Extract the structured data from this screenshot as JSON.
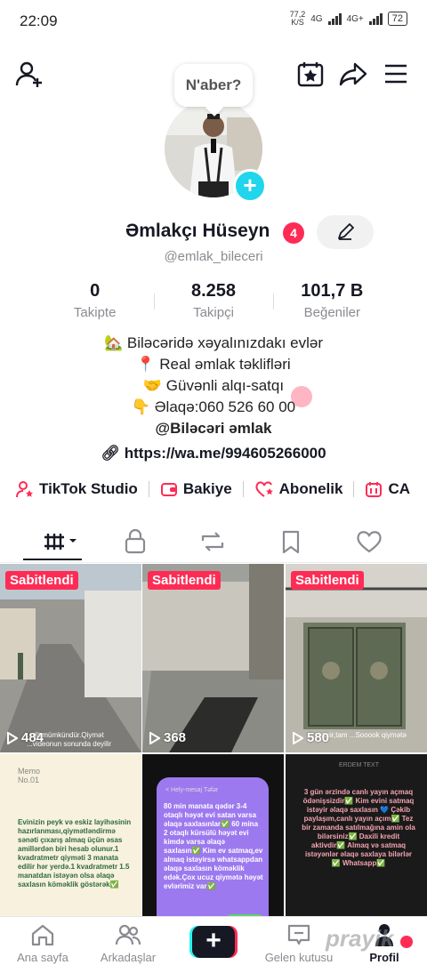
{
  "status_bar": {
    "time": "22:09",
    "speed_value": "77,2",
    "speed_unit": "K/S",
    "net1": "4G",
    "net2": "4G+",
    "battery": "72"
  },
  "header": {
    "bubble_text": "N'aber?"
  },
  "profile": {
    "name": "Əmlakçı Hüseyn",
    "badge_count": "4",
    "username": "@emlak_bileceri",
    "stats": [
      {
        "value": "0",
        "label": "Takipte"
      },
      {
        "value": "8.258",
        "label": "Takipçi"
      },
      {
        "value": "101,7 B",
        "label": "Beğeniler"
      }
    ],
    "bio": [
      "🏡 Biləcəridə xəyalınızdakı evlər",
      "📍 Real əmlak təklifləri",
      "🤝 Güvənli alqı-satqı",
      "👇 Əlaqə:060 526 60 00"
    ],
    "bio_bold": "@Biləcəri əmlak",
    "link": "https://wa.me/994605266000"
  },
  "tools": [
    {
      "label": "TikTok Studio",
      "icon": "person-star-icon"
    },
    {
      "label": "Bakiye",
      "icon": "wallet-icon"
    },
    {
      "label": "Abonelik",
      "icon": "heart-star-icon"
    },
    {
      "label": "CA",
      "icon": "calendar-icon"
    }
  ],
  "videos": [
    {
      "pinned": "Sabitlendi",
      "views": "484",
      "caption": "...dit mümkündür.Qiymət ...videonun sonunda deyilir"
    },
    {
      "pinned": "Sabitlendi",
      "views": "368"
    },
    {
      "pinned": "Sabitlendi",
      "views": "580",
      "caption": "...təmir,tam ...Sooook qiymətə"
    },
    {
      "header": "Memo\nNo.01",
      "text": "Evinizin peyk və eskiz layihəsinin hazırlanması,qiymətləndirmə sənəti çıxarış almaq üçün əsas amillərdən biri hesab olunur.1 kvadratmetr qiyməti 3 manata edilir hər yerdə.1 kvadratmetr 1.5 manatdan istəyən olsa əlaqə saxlasın köməklik göstərək✅"
    },
    {
      "header": "< Hely-mesaj Təfər",
      "text": "80 min manata qədər 3-4 otaqlı həyət evi satan varsa əlaqə saxlasınlar✅ 60 mina 2 otaqlı kürsülü həyət evi kimdə varsa əlaqə saxlasın✅ Kim ev satmaq,ev almaq istəyirsə whatsappdan əlaqə saxlasın köməklik edək.Çox ucuz qiymətə həyət evlərimiz var✅"
    },
    {
      "header": "ERDEM TEXT",
      "text": "3 gün ərzində canlı yayın açmaq ödənişsizdir✅ Kim evini satmaq istəyir əlaqə saxlasın 💙 Çəkib paylaşım,canlı yayın açım✅ Tez bir zamanda satılmağına amin ola bilərsiniz✅ Daxili kredit aktivdir✅ Almaq və satmaq istəyənlər əlaqə saxlaya bilərlər ✅ Whatsapp✅"
    }
  ],
  "nav": [
    {
      "label": "Ana sayfa",
      "icon": "home-icon"
    },
    {
      "label": "Arkadaşlar",
      "icon": "friends-icon"
    },
    {
      "label": "",
      "icon": "plus-icon"
    },
    {
      "label": "Gelen kutusu",
      "icon": "inbox-icon"
    },
    {
      "label": "Profil",
      "icon": "profile-icon"
    }
  ],
  "watermark": "prayik",
  "colors": {
    "accent": "#fe2c55",
    "cyan": "#25f4ee",
    "text": "#161823",
    "muted": "#8a8b91"
  }
}
